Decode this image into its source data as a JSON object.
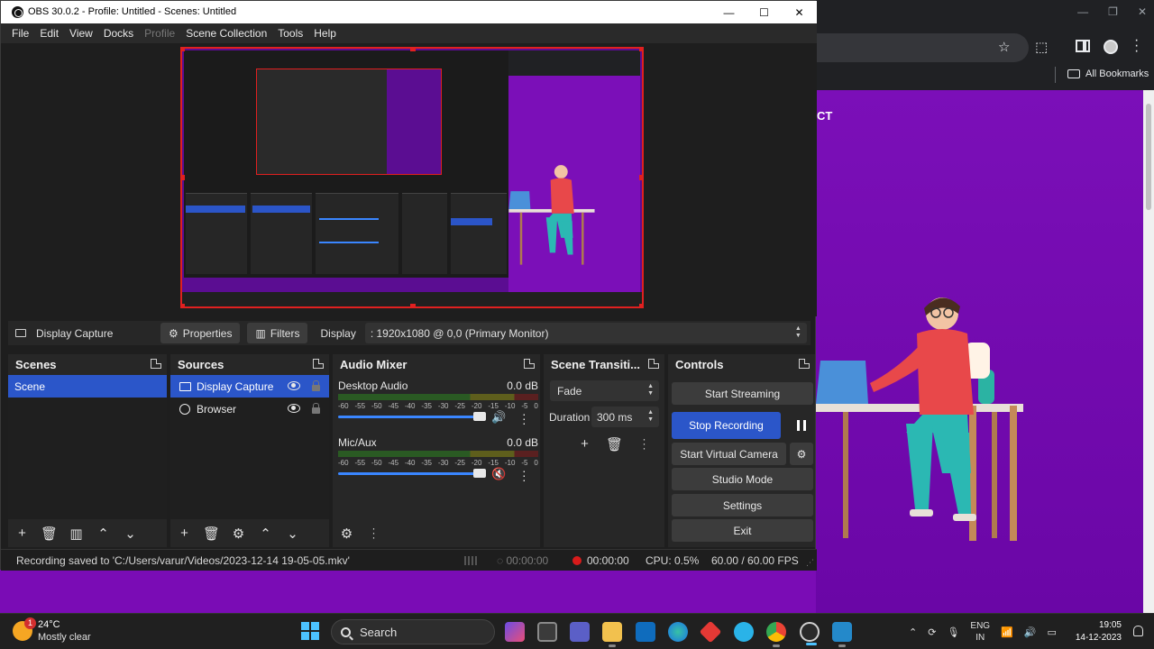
{
  "window": {
    "title": "OBS 30.0.2 - Profile: Untitled - Scenes: Untitled",
    "minimize": "—",
    "maximize": "☐",
    "close": "✕"
  },
  "menu": [
    "File",
    "Edit",
    "View",
    "Docks",
    "Profile",
    "Scene Collection",
    "Tools",
    "Help"
  ],
  "source_toolbar": {
    "source_name": "Display Capture",
    "properties_label": "Properties",
    "filters_label": "Filters",
    "display_label": "Display",
    "display_value": ": 1920x1080 @ 0,0 (Primary Monitor)"
  },
  "scenes": {
    "title": "Scenes",
    "items": [
      "Scene"
    ]
  },
  "sources": {
    "title": "Sources",
    "items": [
      {
        "name": "Display Capture",
        "icon": "monitor-icon"
      },
      {
        "name": "Browser",
        "icon": "globe-icon"
      }
    ]
  },
  "audio_mixer": {
    "title": "Audio Mixer",
    "channels": [
      {
        "name": "Desktop Audio",
        "level": "0.0 dB",
        "volume": 0.9,
        "muted": false
      },
      {
        "name": "Mic/Aux",
        "level": "0.0 dB",
        "volume": 0.9,
        "muted": true
      }
    ],
    "ticks": [
      "-60",
      "-55",
      "-50",
      "-45",
      "-40",
      "-35",
      "-30",
      "-25",
      "-20",
      "-15",
      "-10",
      "-5",
      "0"
    ]
  },
  "transitions": {
    "title": "Scene Transiti...",
    "selected": "Fade",
    "duration_label": "Duration",
    "duration_value": "300 ms"
  },
  "controls": {
    "title": "Controls",
    "start_streaming": "Start Streaming",
    "stop_recording": "Stop Recording",
    "start_virtual_camera": "Start Virtual Camera",
    "studio_mode": "Studio Mode",
    "settings": "Settings",
    "exit": "Exit"
  },
  "status": {
    "message": "Recording saved to 'C:/Users/varur/Videos/2023-12-14 19-05-05.mkv'",
    "stream_time": "00:00:00",
    "record_time": "00:00:00",
    "cpu": "CPU: 0.5%",
    "fps": "60.00 / 60.00 FPS"
  },
  "browser": {
    "bookmarks_label": "All Bookmarks",
    "content_text": "CT"
  },
  "taskbar": {
    "temperature": "24°C",
    "weather": "Mostly clear",
    "weather_badge": "1",
    "search_placeholder": "Search",
    "lang_top": "ENG",
    "lang_bottom": "IN",
    "time": "19:05",
    "date": "14-12-2023"
  },
  "colors": {
    "accent": "#2b56c9",
    "recording": "#d81b1b",
    "preview_border": "#e02020",
    "background_purple": "#6e0aa6"
  }
}
